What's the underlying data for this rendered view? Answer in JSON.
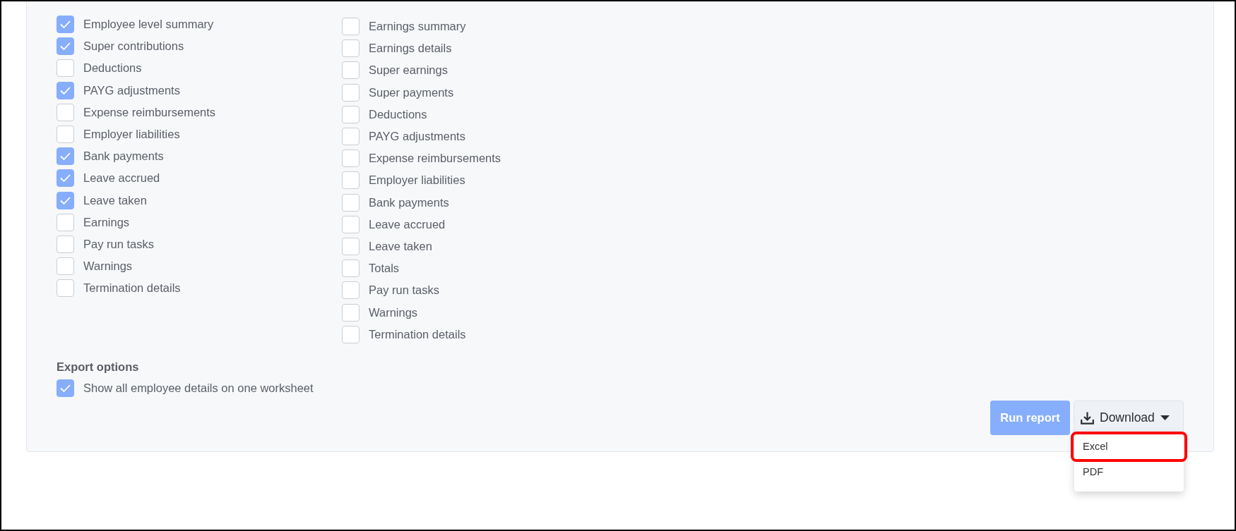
{
  "option_columns": [
    {
      "options": [
        {
          "label": "Employee level summary",
          "checked": true
        },
        {
          "label": "Super contributions",
          "checked": true
        },
        {
          "label": "Deductions",
          "checked": false
        },
        {
          "label": "PAYG adjustments",
          "checked": true
        },
        {
          "label": "Expense reimbursements",
          "checked": false
        },
        {
          "label": "Employer liabilities",
          "checked": false
        },
        {
          "label": "Bank payments",
          "checked": true
        },
        {
          "label": "Leave accrued",
          "checked": true
        },
        {
          "label": "Leave taken",
          "checked": true
        },
        {
          "label": "Earnings",
          "checked": false
        },
        {
          "label": "Pay run tasks",
          "checked": false
        },
        {
          "label": "Warnings",
          "checked": false
        },
        {
          "label": "Termination details",
          "checked": false
        }
      ]
    },
    {
      "options": [
        {
          "label": "Earnings summary",
          "checked": false
        },
        {
          "label": "Earnings details",
          "checked": false
        },
        {
          "label": "Super earnings",
          "checked": false
        },
        {
          "label": "Super payments",
          "checked": false
        },
        {
          "label": "Deductions",
          "checked": false
        },
        {
          "label": "PAYG adjustments",
          "checked": false
        },
        {
          "label": "Expense reimbursements",
          "checked": false
        },
        {
          "label": "Employer liabilities",
          "checked": false
        },
        {
          "label": "Bank payments",
          "checked": false
        },
        {
          "label": "Leave accrued",
          "checked": false
        },
        {
          "label": "Leave taken",
          "checked": false
        },
        {
          "label": "Totals",
          "checked": false
        },
        {
          "label": "Pay run tasks",
          "checked": false
        },
        {
          "label": "Warnings",
          "checked": false
        },
        {
          "label": "Termination details",
          "checked": false
        }
      ]
    }
  ],
  "export_options": {
    "heading": "Export options",
    "options": [
      {
        "label": "Show all employee details on one worksheet",
        "checked": true
      }
    ]
  },
  "actions": {
    "run_report": {
      "label": "Run report"
    },
    "download": {
      "label": "Download",
      "expanded": true,
      "menu": [
        {
          "label": "Excel",
          "highlighted": true
        },
        {
          "label": "PDF",
          "highlighted": false
        }
      ]
    }
  }
}
